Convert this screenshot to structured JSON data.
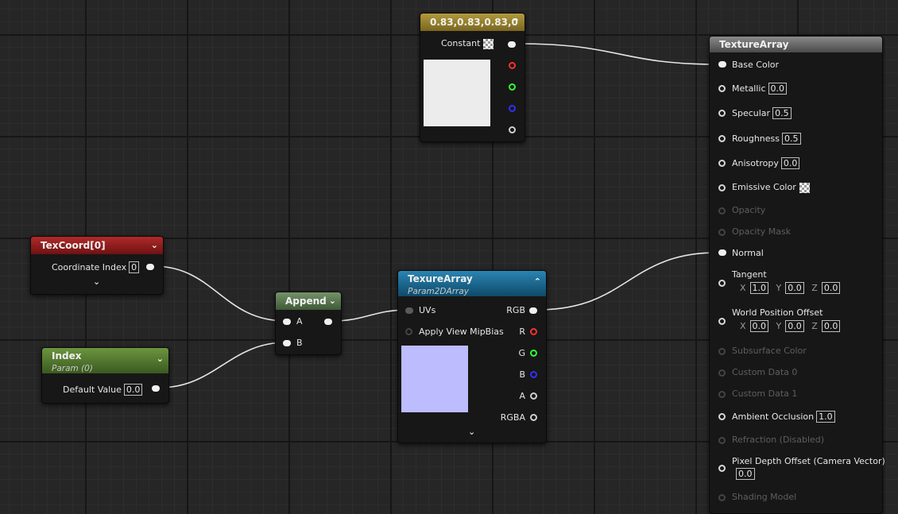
{
  "constant_node": {
    "title": "0.83,0.83,0.83,0",
    "label": "Constant",
    "header_color": "#a08a30",
    "preview_color": "#ececec"
  },
  "texcoord_node": {
    "title": "TexCoord[0]",
    "header_color": "#9a2020",
    "coord_label": "Coordinate Index",
    "coord_value": "0"
  },
  "index_node": {
    "title": "Index",
    "subtitle": "Param (0)",
    "header_color": "#557a30",
    "default_label": "Default Value",
    "default_value": "0.0"
  },
  "append_node": {
    "title": "Append",
    "header_color": "#5f7f55",
    "input_a": "A",
    "input_b": "B"
  },
  "texture_node": {
    "title": "TexureArray",
    "subtitle": "Param2DArray",
    "header_color": "#1a6a92",
    "preview_color": "#bcbcff",
    "inputs": [
      "UVs",
      "Apply View MipBias"
    ],
    "outputs": [
      "RGB",
      "R",
      "G",
      "B",
      "A",
      "RGBA"
    ]
  },
  "material_node": {
    "title": "TextureArray",
    "header_color": "#707070",
    "base_color": "Base Color",
    "metallic": "Metallic",
    "metallic_value": "0.0",
    "specular": "Specular",
    "specular_value": "0.5",
    "roughness": "Roughness",
    "roughness_value": "0.5",
    "anisotropy": "Anisotropy",
    "anisotropy_value": "0.0",
    "emissive": "Emissive Color",
    "opacity": "Opacity",
    "opacity_mask": "Opacity Mask",
    "normal": "Normal",
    "tangent": "Tangent",
    "tangent_x": "1.0",
    "tangent_y": "0.0",
    "tangent_z": "0.0",
    "wpo": "World Position Offset",
    "wpo_x": "0.0",
    "wpo_y": "0.0",
    "wpo_z": "0.0",
    "subsurface": "Subsurface Color",
    "custom0": "Custom Data 0",
    "custom1": "Custom Data 1",
    "ao": "Ambient Occlusion",
    "ao_value": "1.0",
    "refraction": "Refraction (Disabled)",
    "pdo": "Pixel Depth Offset (Camera Vector)",
    "pdo_value": "0.0",
    "shading": "Shading Model",
    "axis_x": "X",
    "axis_y": "Y",
    "axis_z": "Z"
  },
  "icons": {
    "collapse": "chevron-up-icon",
    "expand": "chevron-down-icon",
    "checker": "checker-icon"
  }
}
